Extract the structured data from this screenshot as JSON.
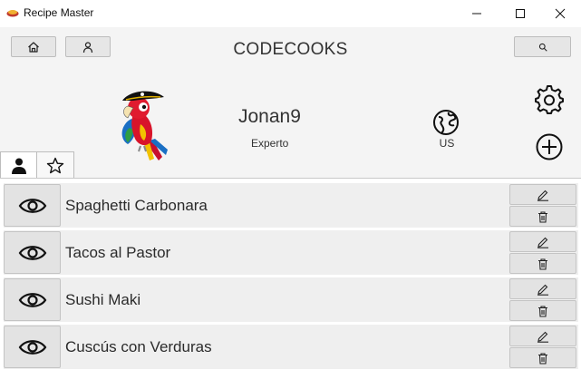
{
  "window": {
    "title": "Recipe Master"
  },
  "header": {
    "brand": "CODECOOKS"
  },
  "profile": {
    "username": "Jonan9",
    "level": "Experto",
    "country": "US"
  },
  "recipes": [
    {
      "name": "Spaghetti Carbonara"
    },
    {
      "name": "Tacos al Pastor"
    },
    {
      "name": "Sushi Maki"
    },
    {
      "name": "Cuscús con Verduras"
    }
  ],
  "icons": {
    "home": "home-icon",
    "user": "user-icon",
    "search": "search-icon",
    "settings": "gear-icon",
    "add": "plus-circle-icon",
    "country": "globe-icon",
    "view": "eye-icon",
    "edit": "pencil-icon",
    "delete": "trash-icon"
  }
}
